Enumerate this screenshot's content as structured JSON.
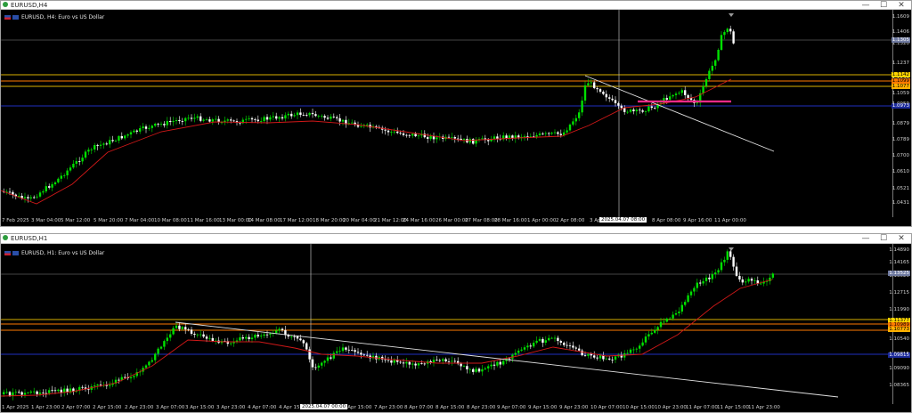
{
  "windows": [
    {
      "title": "EURUSD,H4",
      "symbol_text": "EURUSD, H4: Euro vs US Dollar",
      "price_labels": [
        "1.1609",
        "1.1406",
        "1.1320",
        "1.1237",
        "1.1142",
        "1.1059",
        "1.0959",
        "1.0879",
        "1.0789",
        "1.0700",
        "1.0610",
        "1.0521",
        "1.0431"
      ],
      "time_labels": [
        "7 Feb 2025",
        "3 Mar 04:00",
        "5 Mar 12:00",
        "5 Mar 20:00",
        "7 Mar 04:00",
        "10 Mar 08:00",
        "11 Mar 16:00",
        "13 Mar 00:00",
        "14 Mar 08:00",
        "17 Mar 12:00",
        "18 Mar 20:00",
        "20 Mar 04:00",
        "21 Mar 12:00",
        "24 Mar 16:00",
        "26 Mar 00:00",
        "27 Mar 08:00",
        "28 Mar 16:00",
        "1 Apr 00:00",
        "2 Apr 08:00",
        "3 Apr",
        "8 Apr 08:00",
        "9 Apr 16:00",
        "11 Apr 00:00"
      ],
      "crosshair_time": "2025.04.07 08:00",
      "badges": [
        {
          "text": "1.1305",
          "color": "#6f7aa0"
        },
        {
          "text": "1.1142",
          "color": "#ffd500"
        },
        {
          "text": "1.1099",
          "color": "#ff7a00"
        },
        {
          "text": "1.1077",
          "color": "#ffb000"
        },
        {
          "text": "1.0973",
          "color": "#1c2a9a"
        }
      ]
    },
    {
      "title": "EURUSD,H1",
      "symbol_text": "EURUSD, H1: Euro vs US Dollar",
      "price_labels": [
        "1.14890",
        "1.14165",
        "1.13525",
        "1.12715",
        "1.11990",
        "1.11377",
        "1.10540",
        "1.09815",
        "1.09090",
        "1.08365"
      ],
      "time_labels": [
        "1 Apr 2025",
        "1 Apr 23:00",
        "2 Apr 07:00",
        "2 Apr 15:00",
        "2 Apr 23:00",
        "3 Apr 07:00",
        "3 Apr 15:00",
        "3 Apr 23:00",
        "4 Apr 07:00",
        "4 Apr 15:00",
        "7 Apr 07:00",
        "7 Apr 15:00",
        "7 Apr 23:00",
        "8 Apr 07:00",
        "8 Apr 15:00",
        "8 Apr 23:00",
        "9 Apr 07:00",
        "9 Apr 15:00",
        "9 Apr 23:00",
        "10 Apr 07:00",
        "10 Apr 15:00",
        "10 Apr 23:00",
        "11 Apr 07:00",
        "11 Apr 15:00",
        "11 Apr 23:00"
      ],
      "crosshair_time": "2025.04.07 00:00",
      "badges": [
        {
          "text": "1.13525",
          "color": "#6f7aa0"
        },
        {
          "text": "1.11377",
          "color": "#ffd500"
        },
        {
          "text": "1.10989",
          "color": "#ff7a00"
        },
        {
          "text": "1.10773",
          "color": "#ffb000"
        },
        {
          "text": "1.09815",
          "color": "#1c2a9a"
        }
      ]
    }
  ],
  "colors": {
    "bull_candle": "#00e000",
    "bear_candle": "#ffffff",
    "moving_average": "#d01818",
    "h_yellow": "#d8b000",
    "h_orange": "#ff7a00",
    "h_blue": "#2030c0",
    "trendline": "#e0e0e0",
    "resistance_magenta": "#ff2a8a"
  },
  "icons": {
    "app": "mt-chart-icon",
    "minimize": "minimize-icon",
    "maximize": "maximize-icon",
    "close": "close-icon"
  }
}
